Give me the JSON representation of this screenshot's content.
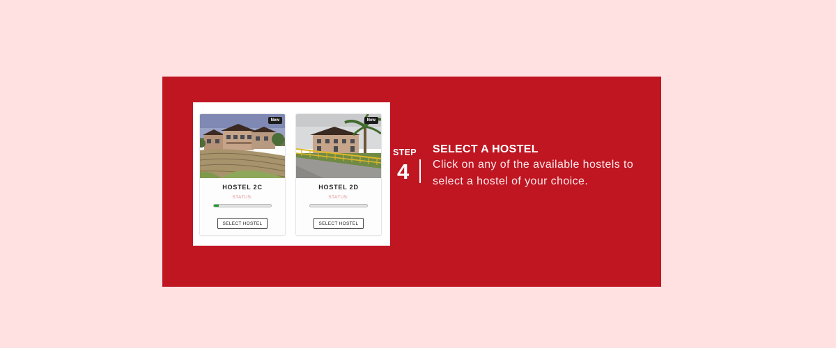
{
  "step": {
    "label": "STEP",
    "number": "4",
    "heading": "SELECT A HOSTEL",
    "description": "Click on any of the available hostels to select a hostel of your choice."
  },
  "hostels": [
    {
      "name": "HOSTEL 2C",
      "badge": "New",
      "status_label": "STATUS:",
      "status_fraction": 0.08,
      "button_label": "SELECT HOSTEL"
    },
    {
      "name": "HOSTEL 2D",
      "badge": "New",
      "status_label": "STATUS:",
      "status_fraction": 0,
      "button_label": "SELECT HOSTEL"
    }
  ],
  "colors": {
    "page_background": "#ffe1e2",
    "panel_red": "#bf1622",
    "progress_green": "#1a9b2a",
    "status_text": "#e08a8e"
  }
}
